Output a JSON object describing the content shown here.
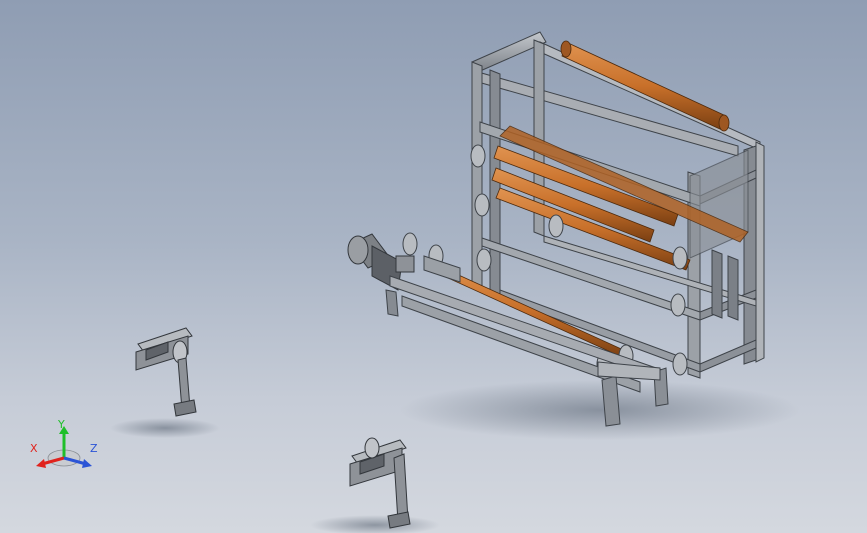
{
  "viewport": {
    "background_top": "#8f9db3",
    "background_bottom": "#d4d8df"
  },
  "colors": {
    "frame_steel": "#9a9fa6",
    "frame_dark": "#4a4f56",
    "roller_orange": "#c8702a",
    "roller_dark": "#7a3f12",
    "motor_grey": "#7d8186"
  },
  "triad": {
    "x_label": "X",
    "y_label": "Y",
    "z_label": "Z",
    "x_color": "#e0231d",
    "y_color": "#1fbf2a",
    "z_color": "#2b54d6"
  },
  "scene_parts": [
    "slitting-machine-main-frame",
    "orange-roller",
    "motor",
    "unwind-stand-left",
    "unwind-stand-bottom"
  ]
}
